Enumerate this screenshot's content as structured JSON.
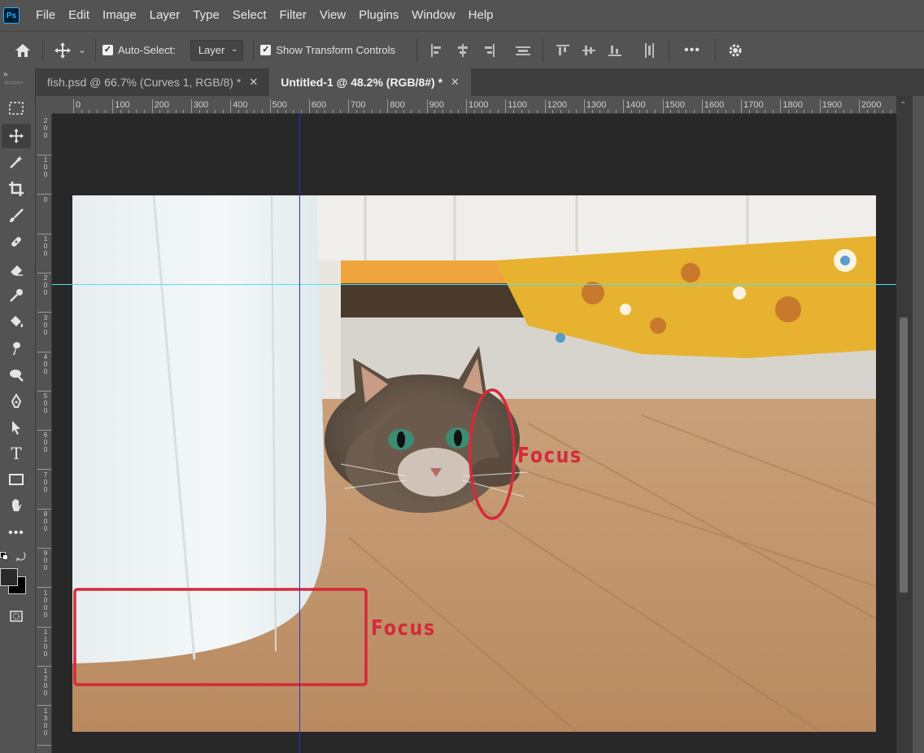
{
  "app": {
    "logo": "Ps"
  },
  "menu": [
    "File",
    "Edit",
    "Image",
    "Layer",
    "Type",
    "Select",
    "Filter",
    "View",
    "Plugins",
    "Window",
    "Help"
  ],
  "options": {
    "auto_select_label": "Auto-Select:",
    "auto_select_checked": true,
    "auto_select_value": "Layer",
    "show_transform_label": "Show Transform Controls",
    "show_transform_checked": true,
    "more": "•••"
  },
  "tabs": [
    {
      "label": "fish.psd @ 66.7% (Curves 1, RGB/8) *",
      "active": false
    },
    {
      "label": "Untitled-1 @ 48.2% (RGB/8#) *",
      "active": true
    }
  ],
  "ruler": {
    "h_labels": [
      "0",
      "100",
      "200",
      "300",
      "400",
      "500",
      "600",
      "700",
      "800",
      "900",
      "1000",
      "1100",
      "1200",
      "1300",
      "1400",
      "1500",
      "1600",
      "1700",
      "1800",
      "1900",
      "2000"
    ],
    "v_labels": [
      "2\n0\n0",
      "1\n0\n0",
      "0",
      "1\n0\n0",
      "2\n0\n0",
      "3\n0\n0",
      "4\n0\n0",
      "5\n0\n0",
      "6\n0\n0",
      "7\n0\n0",
      "8\n0\n0",
      "9\n0\n0",
      "1\n0\n0\n0",
      "1\n1\n0\n0",
      "1\n2\n0\n0",
      "1\n3\n0\n0"
    ]
  },
  "annotations": {
    "focus_eye": "Focus",
    "focus_box": "Focus"
  },
  "colors": {
    "annotation_red": "#d42a3a",
    "guide_cyan": "#4fe3ee",
    "guide_blue": "#2b2bd6",
    "foreground_swatch": "#2a2a2a",
    "background_swatch": "#000000"
  }
}
